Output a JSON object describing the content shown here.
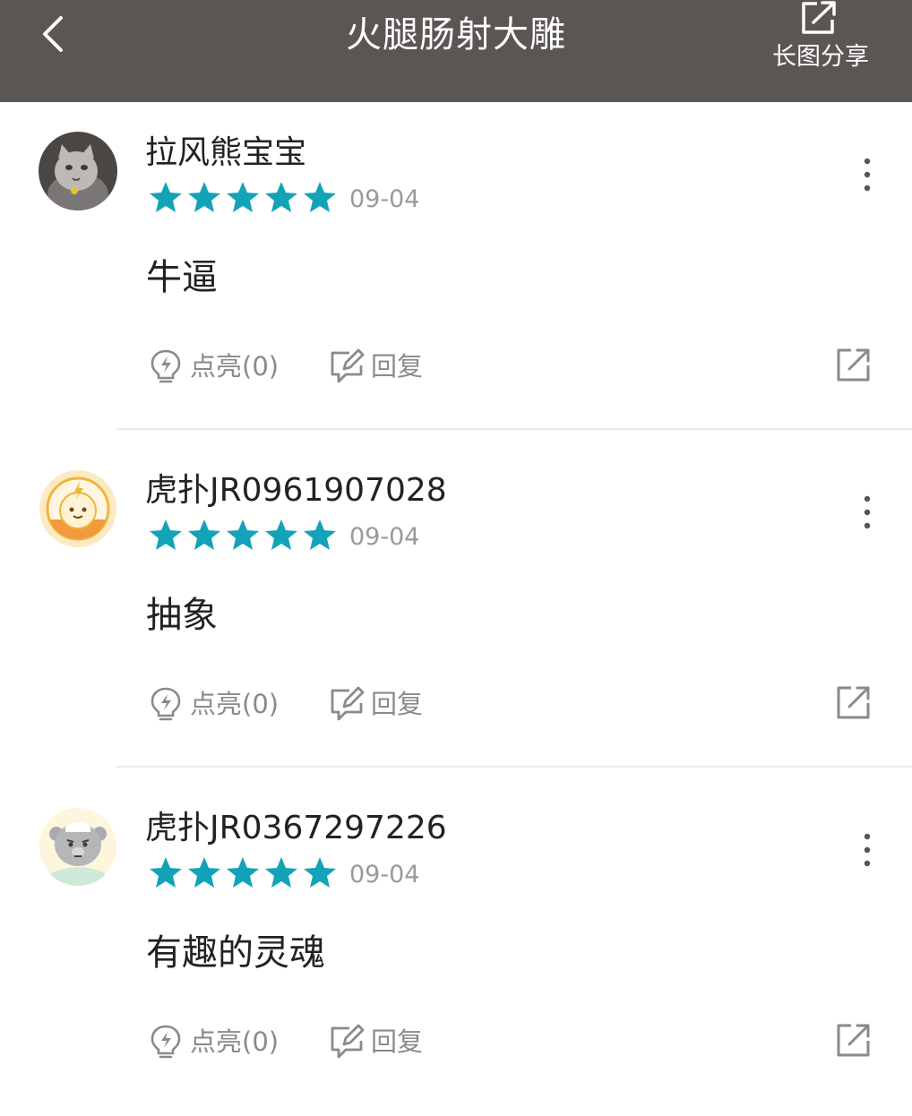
{
  "header": {
    "title": "火腿肠射大雕",
    "share_label": "长图分享",
    "background": "#5b5554"
  },
  "accent_star_color": "#12a3b8",
  "comments": [
    {
      "username": "拉风熊宝宝",
      "rating": 5,
      "date": "09-04",
      "content": "牛逼",
      "like_label": "点亮(0)",
      "reply_label": "回复",
      "avatar": "cat-avatar"
    },
    {
      "username": "虎扑JR0961907028",
      "rating": 5,
      "date": "09-04",
      "content": "抽象",
      "like_label": "点亮(0)",
      "reply_label": "回复",
      "avatar": "lightning-face-avatar"
    },
    {
      "username": "虎扑JR0367297226",
      "rating": 5,
      "date": "09-04",
      "content": "有趣的灵魂",
      "like_label": "点亮(0)",
      "reply_label": "回复",
      "avatar": "grey-bear-avatar"
    }
  ]
}
